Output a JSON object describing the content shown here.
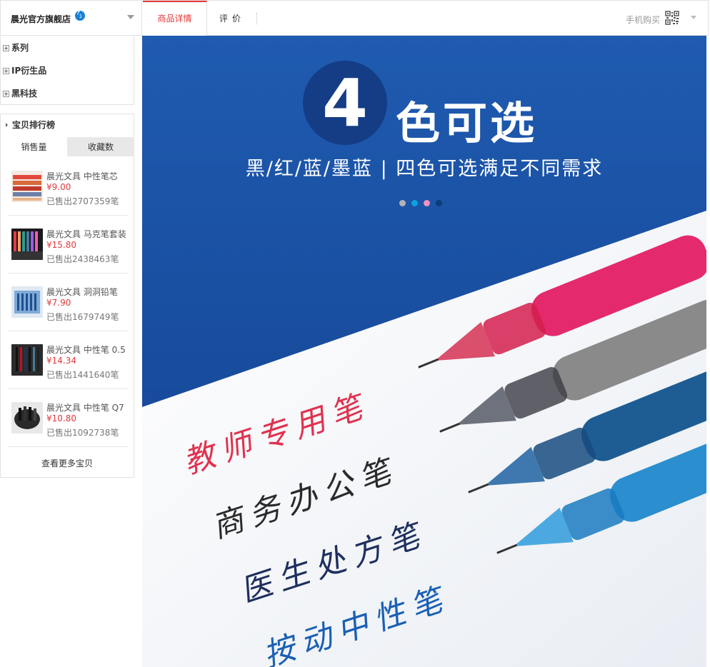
{
  "header": {
    "shop_name": "晨光官方旗舰店",
    "tabs": [
      {
        "label": "商品详情",
        "active": true
      },
      {
        "label": "评价",
        "active": false
      }
    ],
    "mobile_buy_label": "手机购买"
  },
  "sidebar": {
    "categories": [
      {
        "label": "系列"
      },
      {
        "label": "IP衍生品"
      },
      {
        "label": "黑科技"
      }
    ],
    "ranking": {
      "title": "宝贝排行榜",
      "tabs": [
        {
          "label": "销售量",
          "active": true
        },
        {
          "label": "收藏数",
          "active": false
        }
      ],
      "items": [
        {
          "name": "晨光文具 中性笔芯",
          "price": "¥9.00",
          "sold": "已售出2707359笔"
        },
        {
          "name": "晨光文具 马克笔套装",
          "price": "¥15.80",
          "sold": "已售出2438463笔"
        },
        {
          "name": "晨光文具 洞洞铅笔",
          "price": "¥7.90",
          "sold": "已售出1679749笔"
        },
        {
          "name": "晨光文具 中性笔 0.5",
          "price": "¥14.34",
          "sold": "已售出1441640笔"
        },
        {
          "name": "晨光文具 中性笔 Q7",
          "price": "¥10.80",
          "sold": "已售出1092738笔"
        }
      ],
      "more_label": "查看更多宝贝"
    }
  },
  "banner": {
    "number": "4",
    "title": "色可选",
    "subtitle": "黑/红/蓝/墨蓝 | 四色可选满足不同需求",
    "color_dots": [
      "#b4b4b4",
      "#0aa2e0",
      "#f28fc4",
      "#0c3d7a"
    ],
    "handwriting": [
      {
        "text": "教师专用笔",
        "color": "#e0324f"
      },
      {
        "text": "商务办公笔",
        "color": "#2a2a2a"
      },
      {
        "text": "医生处方笔",
        "color": "#1e2f5e"
      },
      {
        "text": "按动中性笔",
        "color": "#1a5fb4"
      }
    ],
    "pen_colors": [
      "#e42a6c",
      "#8a8a8a",
      "#1e5d93",
      "#2a8ecf"
    ]
  }
}
